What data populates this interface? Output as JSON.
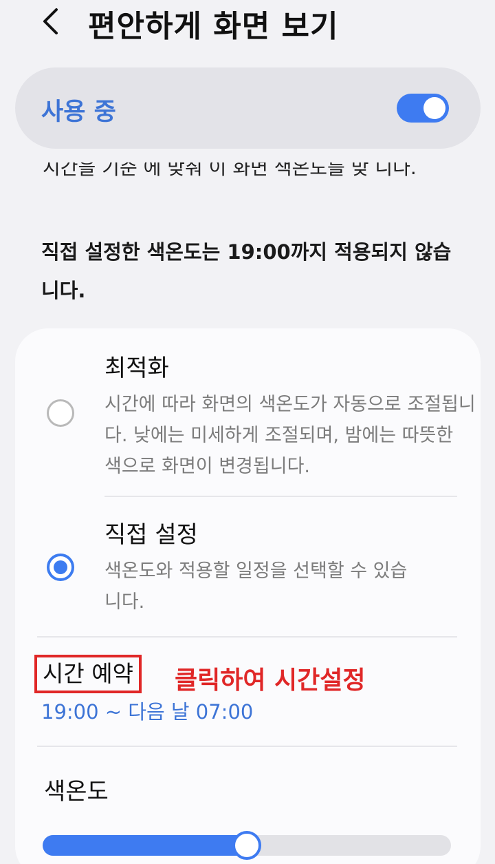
{
  "header": {
    "title": "편안하게 화면 보기",
    "back_icon": "chevron-left-icon"
  },
  "master_switch": {
    "label": "사용 중",
    "on": true,
    "accent": "#3e7bf1"
  },
  "clipped_text": "시간을 기준 에 맞춰 이 화면 색온도를 맞 니다.",
  "notice": "직접 설정한 색온도는 19:00까지 적용되지 않습니다.",
  "options": [
    {
      "title": "최적화",
      "description": "시간에 따라 화면의 색온도가 자동으로 조절됩니다. 낮에는 미세하게 조절되며, 밤에는 따뜻한 색으로 화면이 변경됩니다.",
      "selected": false
    },
    {
      "title": "직접 설정",
      "description": "색온도와 적용할 일정을 선택할 수 있습니다.",
      "selected": true
    }
  ],
  "schedule": {
    "label": "시간 예약",
    "annotation": "클릭하여 시간설정",
    "value": "19:00 ~ 다음 날 07:00"
  },
  "color_temperature": {
    "label": "색온도",
    "level": 0.5
  },
  "colors": {
    "accent": "#3e7bf1",
    "link_blue": "#3d74d6",
    "annotation_red": "#e02727"
  }
}
